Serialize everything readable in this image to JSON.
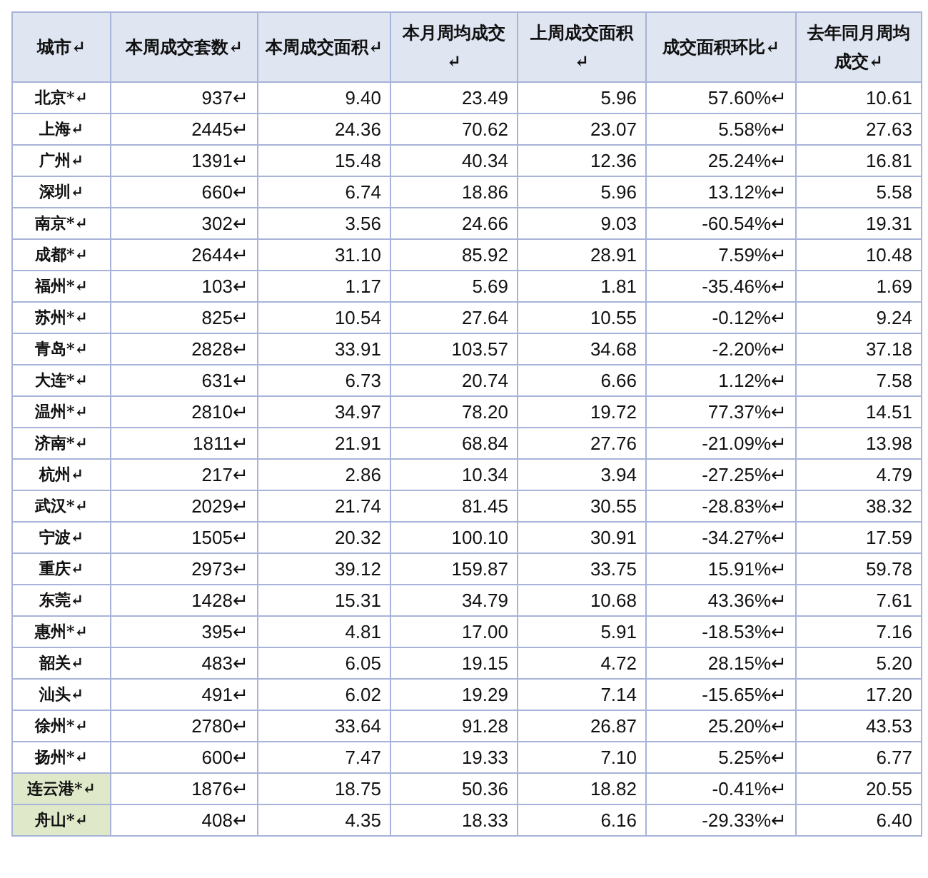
{
  "table": {
    "columns": [
      "城市↵",
      "本周成交套数↵",
      "本周成交面积↵",
      "本月周均成交↵",
      "上周成交面积↵",
      "成交面积环比↵",
      "去年同月周均成交↵"
    ],
    "rows": [
      {
        "highlighted": false,
        "cells": [
          "北京*↵",
          "937↵",
          "9.40",
          "23.49",
          "5.96",
          "57.60%↵",
          "10.61"
        ]
      },
      {
        "highlighted": false,
        "cells": [
          "上海↵",
          "2445↵",
          "24.36",
          "70.62",
          "23.07",
          "5.58%↵",
          "27.63"
        ]
      },
      {
        "highlighted": false,
        "cells": [
          "广州↵",
          "1391↵",
          "15.48",
          "40.34",
          "12.36",
          "25.24%↵",
          "16.81"
        ]
      },
      {
        "highlighted": false,
        "cells": [
          "深圳↵",
          "660↵",
          "6.74",
          "18.86",
          "5.96",
          "13.12%↵",
          "5.58"
        ]
      },
      {
        "highlighted": false,
        "cells": [
          "南京*↵",
          "302↵",
          "3.56",
          "24.66",
          "9.03",
          "-60.54%↵",
          "19.31"
        ]
      },
      {
        "highlighted": false,
        "cells": [
          "成都*↵",
          "2644↵",
          "31.10",
          "85.92",
          "28.91",
          "7.59%↵",
          "10.48"
        ]
      },
      {
        "highlighted": false,
        "cells": [
          "福州*↵",
          "103↵",
          "1.17",
          "5.69",
          "1.81",
          "-35.46%↵",
          "1.69"
        ]
      },
      {
        "highlighted": false,
        "cells": [
          "苏州*↵",
          "825↵",
          "10.54",
          "27.64",
          "10.55",
          "-0.12%↵",
          "9.24"
        ]
      },
      {
        "highlighted": false,
        "cells": [
          "青岛*↵",
          "2828↵",
          "33.91",
          "103.57",
          "34.68",
          "-2.20%↵",
          "37.18"
        ]
      },
      {
        "highlighted": false,
        "cells": [
          "大连*↵",
          "631↵",
          "6.73",
          "20.74",
          "6.66",
          "1.12%↵",
          "7.58"
        ]
      },
      {
        "highlighted": false,
        "cells": [
          "温州*↵",
          "2810↵",
          "34.97",
          "78.20",
          "19.72",
          "77.37%↵",
          "14.51"
        ]
      },
      {
        "highlighted": false,
        "cells": [
          "济南*↵",
          "1811↵",
          "21.91",
          "68.84",
          "27.76",
          "-21.09%↵",
          "13.98"
        ]
      },
      {
        "highlighted": false,
        "cells": [
          "杭州↵",
          "217↵",
          "2.86",
          "10.34",
          "3.94",
          "-27.25%↵",
          "4.79"
        ]
      },
      {
        "highlighted": false,
        "cells": [
          "武汉*↵",
          "2029↵",
          "21.74",
          "81.45",
          "30.55",
          "-28.83%↵",
          "38.32"
        ]
      },
      {
        "highlighted": false,
        "cells": [
          "宁波↵",
          "1505↵",
          "20.32",
          "100.10",
          "30.91",
          "-34.27%↵",
          "17.59"
        ]
      },
      {
        "highlighted": false,
        "cells": [
          "重庆↵",
          "2973↵",
          "39.12",
          "159.87",
          "33.75",
          "15.91%↵",
          "59.78"
        ]
      },
      {
        "highlighted": false,
        "cells": [
          "东莞↵",
          "1428↵",
          "15.31",
          "34.79",
          "10.68",
          "43.36%↵",
          "7.61"
        ]
      },
      {
        "highlighted": false,
        "cells": [
          "惠州*↵",
          "395↵",
          "4.81",
          "17.00",
          "5.91",
          "-18.53%↵",
          "7.16"
        ]
      },
      {
        "highlighted": false,
        "cells": [
          "韶关↵",
          "483↵",
          "6.05",
          "19.15",
          "4.72",
          "28.15%↵",
          "5.20"
        ]
      },
      {
        "highlighted": false,
        "cells": [
          "汕头↵",
          "491↵",
          "6.02",
          "19.29",
          "7.14",
          "-15.65%↵",
          "17.20"
        ]
      },
      {
        "highlighted": false,
        "cells": [
          "徐州*↵",
          "2780↵",
          "33.64",
          "91.28",
          "26.87",
          "25.20%↵",
          "43.53"
        ]
      },
      {
        "highlighted": false,
        "cells": [
          "扬州*↵",
          "600↵",
          "7.47",
          "19.33",
          "7.10",
          "5.25%↵",
          "6.77"
        ]
      },
      {
        "highlighted": true,
        "cells": [
          "连云港*↵",
          "1876↵",
          "18.75",
          "50.36",
          "18.82",
          "-0.41%↵",
          "20.55"
        ]
      },
      {
        "highlighted": true,
        "cells": [
          "舟山*↵",
          "408↵",
          "4.35",
          "18.33",
          "6.16",
          "-29.33%↵",
          "6.40"
        ]
      }
    ]
  }
}
